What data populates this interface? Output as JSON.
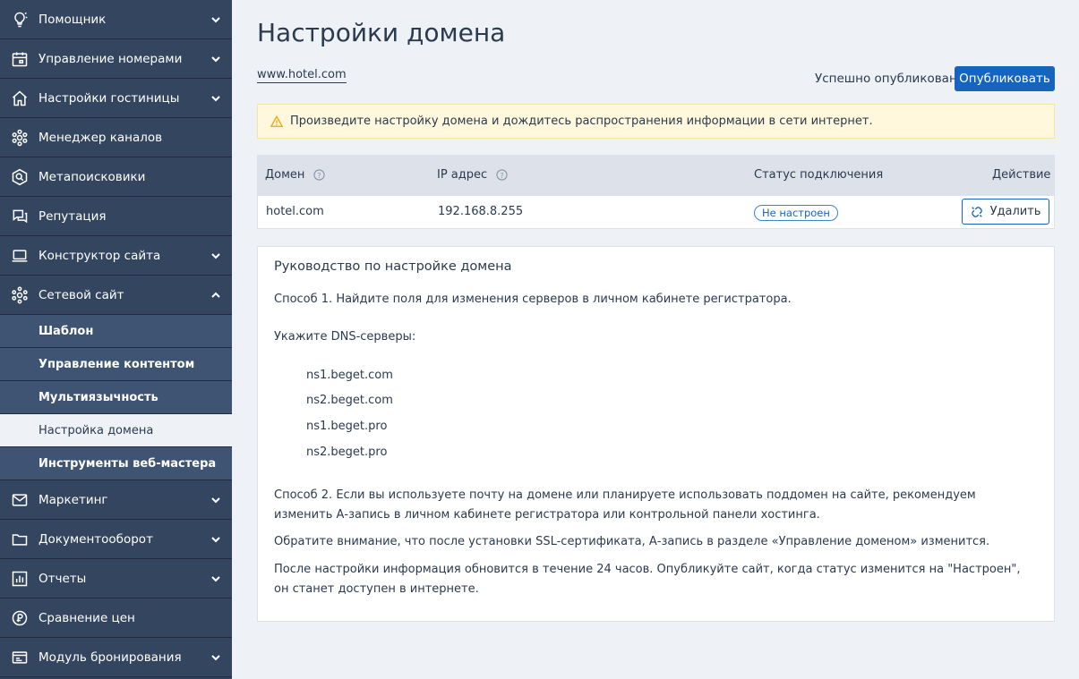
{
  "sidebar": {
    "items": [
      {
        "label": "Помощник",
        "icon": "lightbulb-icon",
        "chevron": "down"
      },
      {
        "label": "Управление номерами",
        "icon": "calendar-icon",
        "chevron": "down"
      },
      {
        "label": "Настройки гостиницы",
        "icon": "home-icon",
        "chevron": "down"
      },
      {
        "label": "Менеджер каналов",
        "icon": "channels-icon",
        "chevron": ""
      },
      {
        "label": "Метапоисковики",
        "icon": "hexagon-search-icon",
        "chevron": ""
      },
      {
        "label": "Репутация",
        "icon": "chat-icon",
        "chevron": ""
      },
      {
        "label": "Конструктор сайта",
        "icon": "laptop-icon",
        "chevron": "down"
      },
      {
        "label": "Сетевой сайт",
        "icon": "network-icon",
        "chevron": "up"
      }
    ],
    "subitems": [
      {
        "label": "Шаблон",
        "active": false
      },
      {
        "label": "Управление контентом",
        "active": false
      },
      {
        "label": "Мультиязычность",
        "active": false
      },
      {
        "label": "Настройка домена",
        "active": true
      },
      {
        "label": "Инструменты веб-мастера",
        "active": false
      }
    ],
    "items_after": [
      {
        "label": "Маркетинг",
        "icon": "mail-icon",
        "chevron": "down"
      },
      {
        "label": "Документооборот",
        "icon": "folder-icon",
        "chevron": "down"
      },
      {
        "label": "Отчеты",
        "icon": "chart-icon",
        "chevron": "down"
      },
      {
        "label": "Сравнение цен",
        "icon": "price-compare-icon",
        "chevron": ""
      },
      {
        "label": "Модуль бронирования",
        "icon": "booking-icon",
        "chevron": "down"
      }
    ]
  },
  "main": {
    "title": "Настройки домена",
    "domain_link": "www.hotel.com",
    "publish_status": "Успешно опубликовано",
    "publish_button": "Опубликовать",
    "warning": "Произведите настройку домена и дождитесь распространения информации в сети интернет.",
    "table": {
      "headers": {
        "domain": "Домен",
        "ip": "IP адрес",
        "status": "Статус подключения",
        "action": "Действие"
      },
      "row": {
        "domain": "hotel.com",
        "ip": "192.168.8.255",
        "status": "Не настроен",
        "action": "Удалить"
      }
    },
    "guide": {
      "title": "Руководство по настройке домена",
      "method1": "Способ 1. Найдите поля для изменения серверов в личном кабинете регистратора.",
      "dns_label": "Укажите DNS-серверы:",
      "dns": [
        "ns1.beget.com",
        "ns2.beget.com",
        "ns1.beget.pro",
        "ns2.beget.pro"
      ],
      "method2": "Способ 2. Если вы используете почту на домене или планируете использовать поддомен на сайте, рекомендуем изменить А-запись в личном кабинете регистратора или контрольной панели хостинга.",
      "note_ssl": "Обратите внимание, что после установки SSL-сертификата, А-запись в разделе «Управление доменом» изменится.",
      "note_time": "После настройки информация обновится в течение 24 часов. Опубликуйте сайт, когда статус изменится на \"Настроен\", он станет доступен в интернете."
    }
  }
}
